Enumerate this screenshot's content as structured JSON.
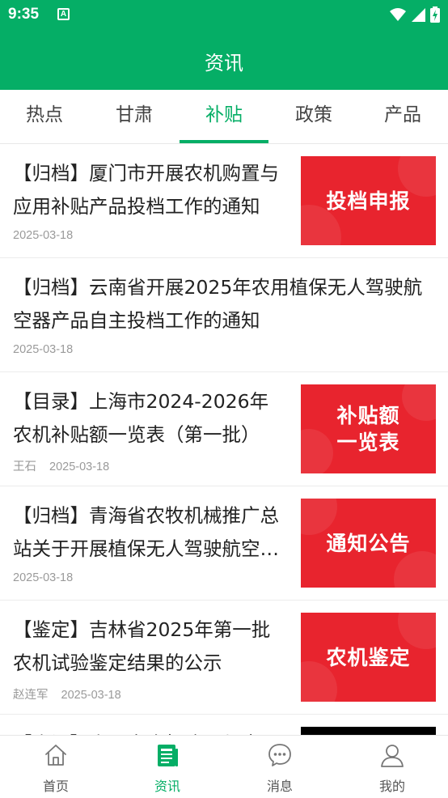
{
  "status_bar": {
    "time": "9:35",
    "notification_letter": "A"
  },
  "app_bar": {
    "title": "资讯"
  },
  "tabs": [
    {
      "label": "热点",
      "active": false
    },
    {
      "label": "甘肃",
      "active": false
    },
    {
      "label": "补贴",
      "active": true
    },
    {
      "label": "政策",
      "active": false
    },
    {
      "label": "产品",
      "active": false
    }
  ],
  "news": [
    {
      "title": "【归档】厦门市开展农机购置与应用补贴产品投档工作的通知",
      "author": "",
      "date": "2025-03-18",
      "thumb_text": "投档申报"
    },
    {
      "title": "【归档】云南省开展2025年农用植保无人驾驶航空器产品自主投档工作的通知",
      "author": "",
      "date": "2025-03-18",
      "thumb_text": ""
    },
    {
      "title": "【目录】上海市2024-2026年农机补贴额一览表（第一批）",
      "author": "王石",
      "date": "2025-03-18",
      "thumb_text": "补贴额\n一览表"
    },
    {
      "title": "【归档】青海省农牧机械推广总站关于开展植保无人驾驶航空器投档工作的通知",
      "author": "",
      "date": "2025-03-18",
      "thumb_text": "通知公告"
    },
    {
      "title": "【鉴定】吉林省2025年第一批农机试验鉴定结果的公示",
      "author": "赵连军",
      "date": "2025-03-18",
      "thumb_text": "农机鉴定"
    },
    {
      "title": "【资讯】山西省农机购置与应用补贴工作动态",
      "author": "",
      "date": "",
      "thumb_text": ""
    }
  ],
  "bottom_nav": [
    {
      "label": "首页",
      "icon": "home-icon",
      "active": false
    },
    {
      "label": "资讯",
      "icon": "news-icon",
      "active": true
    },
    {
      "label": "消息",
      "icon": "message-icon",
      "active": false
    },
    {
      "label": "我的",
      "icon": "profile-icon",
      "active": false
    }
  ],
  "colors": {
    "brand": "#05ae66",
    "thumb_red": "#e8242e"
  }
}
